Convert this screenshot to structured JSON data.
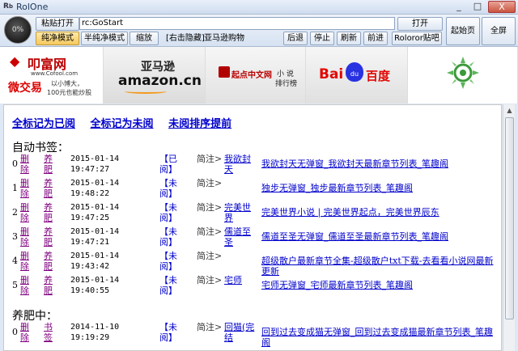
{
  "window": {
    "title": "RolOne",
    "minimize": "_",
    "maximize": "□",
    "close": "X"
  },
  "toolbar": {
    "zoom_label": "0%",
    "paste_open": "粘贴打开",
    "url_value": "rc:GoStart",
    "open": "打开",
    "start_page": "起始页",
    "fullscreen": "全屏",
    "pure_mode": "纯净模式",
    "semi_pure_mode": "半纯净模式",
    "shrink": "缩放",
    "hide_hint": "[右击隐藏]",
    "amazon_shop": "亚马逊购物",
    "back": "后退",
    "stop": "停止",
    "refresh": "刷新",
    "forward": "前进",
    "forum": "Roloror贴吧"
  },
  "banner": {
    "cofool_name": "叩富网",
    "cofool_sub": "微交易",
    "cofool_url": "www.Cofool.com",
    "cofool_slogan1": "以小博大，",
    "cofool_slogan2": "100元也能炒股",
    "amazon_cn": "亚马逊",
    "amazon_en": "amazon.cn",
    "qidian_name": "起点中文网",
    "qidian_side": "小 说",
    "qidian_side2": "排行榜",
    "baidu_text": "Bai",
    "baidu_cn": "百度"
  },
  "content": {
    "mark_all_read": "全标记为已阅",
    "mark_all_unread": "全标记为未阅",
    "sort_unread_first": "未阅排序提前",
    "auto_bookmarks_title": "自动书签：",
    "fattening_title": "养肥中：",
    "auto_rows": [
      {
        "index": "0",
        "delete": "删除",
        "feed": "养肥",
        "date": "2015-01-14",
        "time": "19:47:27",
        "status": "【已阅】",
        "note": "简注>",
        "book": "我欲封天",
        "latest": "我欲封天无弹窗_我欲封天最新章节列表_笔趣阁"
      },
      {
        "index": "1",
        "delete": "删除",
        "feed": "养肥",
        "date": "2015-01-14",
        "time": "19:48:22",
        "status": "【未阅】",
        "note": "简注>",
        "book": "",
        "latest": "独步无弹窗_独步最新章节列表_笔趣阁"
      },
      {
        "index": "2",
        "delete": "删除",
        "feed": "养肥",
        "date": "2015-01-14",
        "time": "19:47:25",
        "status": "【未阅】",
        "note": "简注>",
        "book": "完美世界",
        "latest": "完美世界小说 | 完美世界起点，完美世界辰东"
      },
      {
        "index": "3",
        "delete": "删除",
        "feed": "养肥",
        "date": "2015-01-14",
        "time": "19:47:21",
        "status": "【未阅】",
        "note": "简注>",
        "book": "儒道至圣",
        "latest": "儒道至圣无弹窗_儒道至圣最新章节列表_笔趣阁"
      },
      {
        "index": "4",
        "delete": "删除",
        "feed": "养肥",
        "date": "2015-01-14",
        "time": "19:43:42",
        "status": "【未阅】",
        "note": "简注>",
        "book": "",
        "latest": "超级散户最新章节全集-超级散户txt下载-去看看小说网最新更新"
      },
      {
        "index": "5",
        "delete": "删除",
        "feed": "养肥",
        "date": "2015-01-14",
        "time": "19:40:55",
        "status": "【未阅】",
        "note": "简注>",
        "book": "宅师",
        "latest": "宅师无弹窗_宅师最新章节列表_笔趣阁"
      }
    ],
    "fatten_rows": [
      {
        "index": "0",
        "delete": "删除",
        "feed": "书签",
        "date": "2014-11-10",
        "time": "19:19:29",
        "status": "【未阅】",
        "note": "简注>",
        "book": "回猫(完结",
        "latest": "回到过去变成猫无弹窗_回到过去变成猫最新章节列表_笔趣阁"
      }
    ]
  },
  "colors": {
    "link": "#0000cc",
    "visited": "#800080",
    "toolbar_bg": "#dfe8f5",
    "active_tab": "#f5c95f"
  }
}
